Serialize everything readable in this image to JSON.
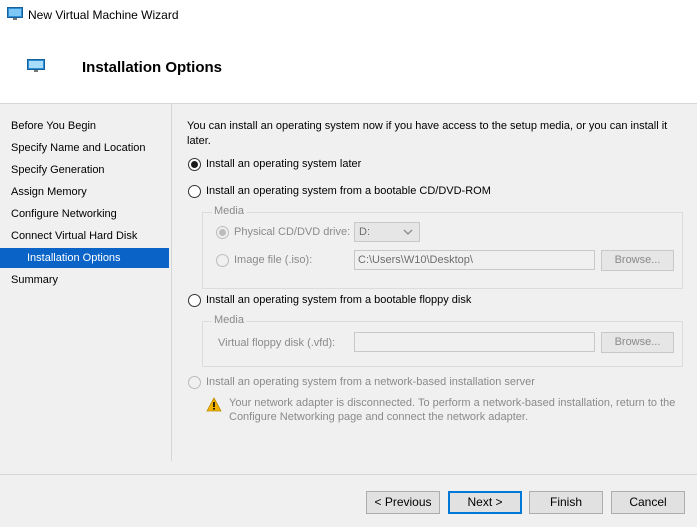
{
  "window": {
    "title": "New Virtual Machine Wizard"
  },
  "header": {
    "title": "Installation Options"
  },
  "nav": {
    "items": [
      {
        "label": "Before You Begin"
      },
      {
        "label": "Specify Name and Location"
      },
      {
        "label": "Specify Generation"
      },
      {
        "label": "Assign Memory"
      },
      {
        "label": "Configure Networking"
      },
      {
        "label": "Connect Virtual Hard Disk"
      },
      {
        "label": "Installation Options",
        "selected": true
      },
      {
        "label": "Summary"
      }
    ]
  },
  "content": {
    "intro": "You can install an operating system now if you have access to the setup media, or you can install it later.",
    "option_later": "Install an operating system later",
    "option_cd": "Install an operating system from a bootable CD/DVD-ROM",
    "cd_media": {
      "group_label": "Media",
      "physical_label": "Physical CD/DVD drive:",
      "physical_value": "D:",
      "image_label": "Image file (.iso):",
      "image_value": "C:\\Users\\W10\\Desktop\\",
      "browse_label": "Browse..."
    },
    "option_floppy": "Install an operating system from a bootable floppy disk",
    "floppy_media": {
      "group_label": "Media",
      "vfd_label": "Virtual floppy disk (.vfd):",
      "vfd_value": "",
      "browse_label": "Browse..."
    },
    "option_network": "Install an operating system from a network-based installation server",
    "network_warning": "Your network adapter is disconnected. To perform a network-based installation, return to the Configure Networking page and connect the network adapter."
  },
  "buttons": {
    "previous": "< Previous",
    "next": "Next >",
    "finish": "Finish",
    "cancel": "Cancel"
  },
  "icons": {
    "window": "virtual-machine-icon",
    "header": "virtual-machine-icon",
    "warning": "warning-icon",
    "dropdown": "chevron-down-icon"
  },
  "colors": {
    "selected_nav": "#0a64c8",
    "warning": "#f0b400",
    "default_button_border": "#0078d7"
  }
}
